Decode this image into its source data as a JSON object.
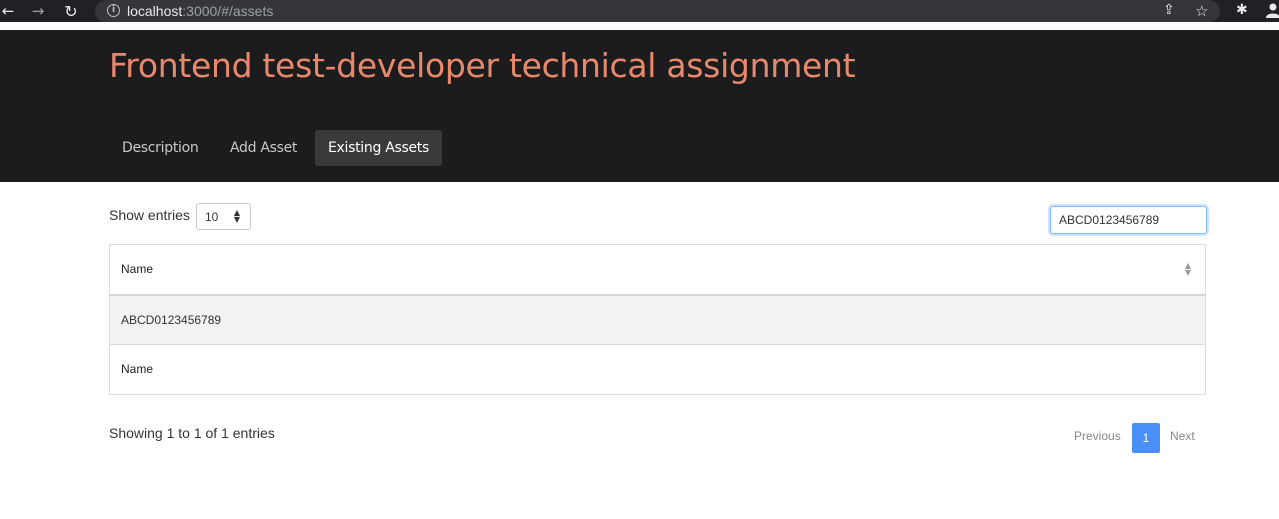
{
  "browser": {
    "url_host": "localhost",
    "url_path": ":3000/#/assets",
    "icons": [
      "back-arrow-icon",
      "forward-arrow-icon",
      "reload-icon",
      "info-icon",
      "share-icon",
      "star-icon",
      "extensions-icon",
      "profile-icon"
    ]
  },
  "header": {
    "title": "Frontend test-developer technical assignment",
    "tabs": [
      {
        "label": "Description",
        "active": false
      },
      {
        "label": "Add Asset",
        "active": false
      },
      {
        "label": "Existing Assets",
        "active": true
      }
    ]
  },
  "controls": {
    "length_label": "Show entries",
    "length_value": "10",
    "search_value": "ABCD0123456789"
  },
  "table": {
    "header": "Name",
    "rows": [
      "ABCD0123456789"
    ],
    "footer": "Name"
  },
  "pagination": {
    "info": "Showing 1 to 1 of 1 entries",
    "previous": "Previous",
    "current_page": "1",
    "next": "Next"
  },
  "colors": {
    "title": "#e8896b",
    "header_bg": "#1c1c1e",
    "active_tab": "#3a3a3c",
    "page_active": "#4a8ff5"
  }
}
